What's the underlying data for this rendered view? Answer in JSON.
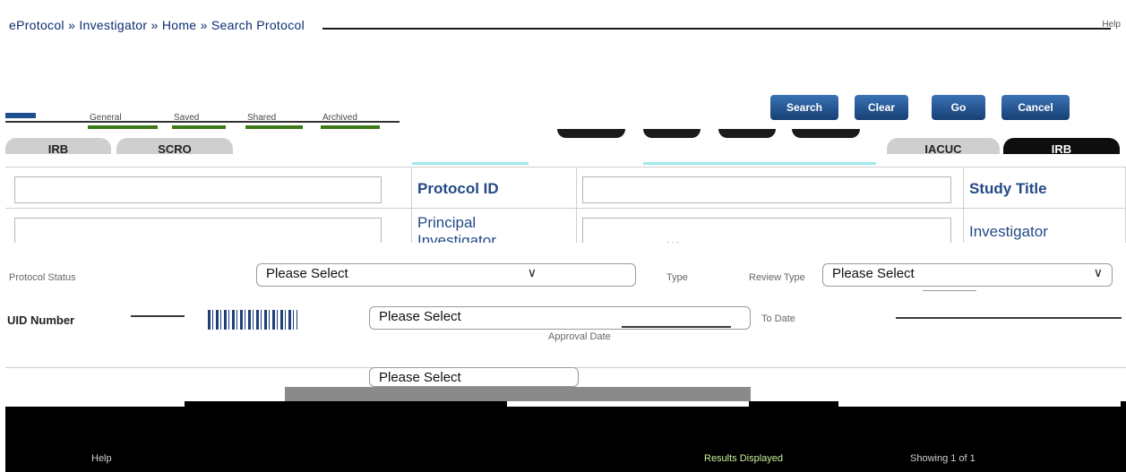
{
  "breadcrumb": {
    "items": [
      "eProtocol",
      "Investigator",
      "Home",
      "Search Protocol"
    ],
    "separator": "»",
    "corner_text": "Help"
  },
  "subtabs": [
    "General",
    "Saved",
    "Shared",
    "Archived"
  ],
  "buttons": [
    "Search",
    "Clear",
    "Go",
    "Cancel"
  ],
  "module_tabs": [
    {
      "label": "IRB",
      "active": false
    },
    {
      "label": "SCRO",
      "active": false
    },
    {
      "label": "IACUC",
      "active": false
    },
    {
      "label": "IRB",
      "active": true
    }
  ],
  "form": {
    "protocol_id_label": "Protocol ID",
    "study_title_label": "Study Title",
    "principal_label_line1": "Principal",
    "principal_label_line2": "Investigator",
    "investigator_label": "Investigator"
  },
  "dropdowns": {
    "placeholder": "Please Select",
    "chevron": "∨"
  },
  "row3": {
    "left_text": "Protocol Status",
    "mid_text": "Type",
    "right_text": "Review Type"
  },
  "row4": {
    "left_text": "UID Number",
    "mid_text": "Approval Date",
    "right_text": "To Date"
  },
  "footer": {
    "left": "Help",
    "mid": "Results Displayed",
    "right": "Showing 1 of 1"
  },
  "colors": {
    "brand_blue": "#244a86",
    "button_blue": "#1f4f8f",
    "accent_green": "#3d7a17",
    "active_tab": "#0e0e0e"
  }
}
